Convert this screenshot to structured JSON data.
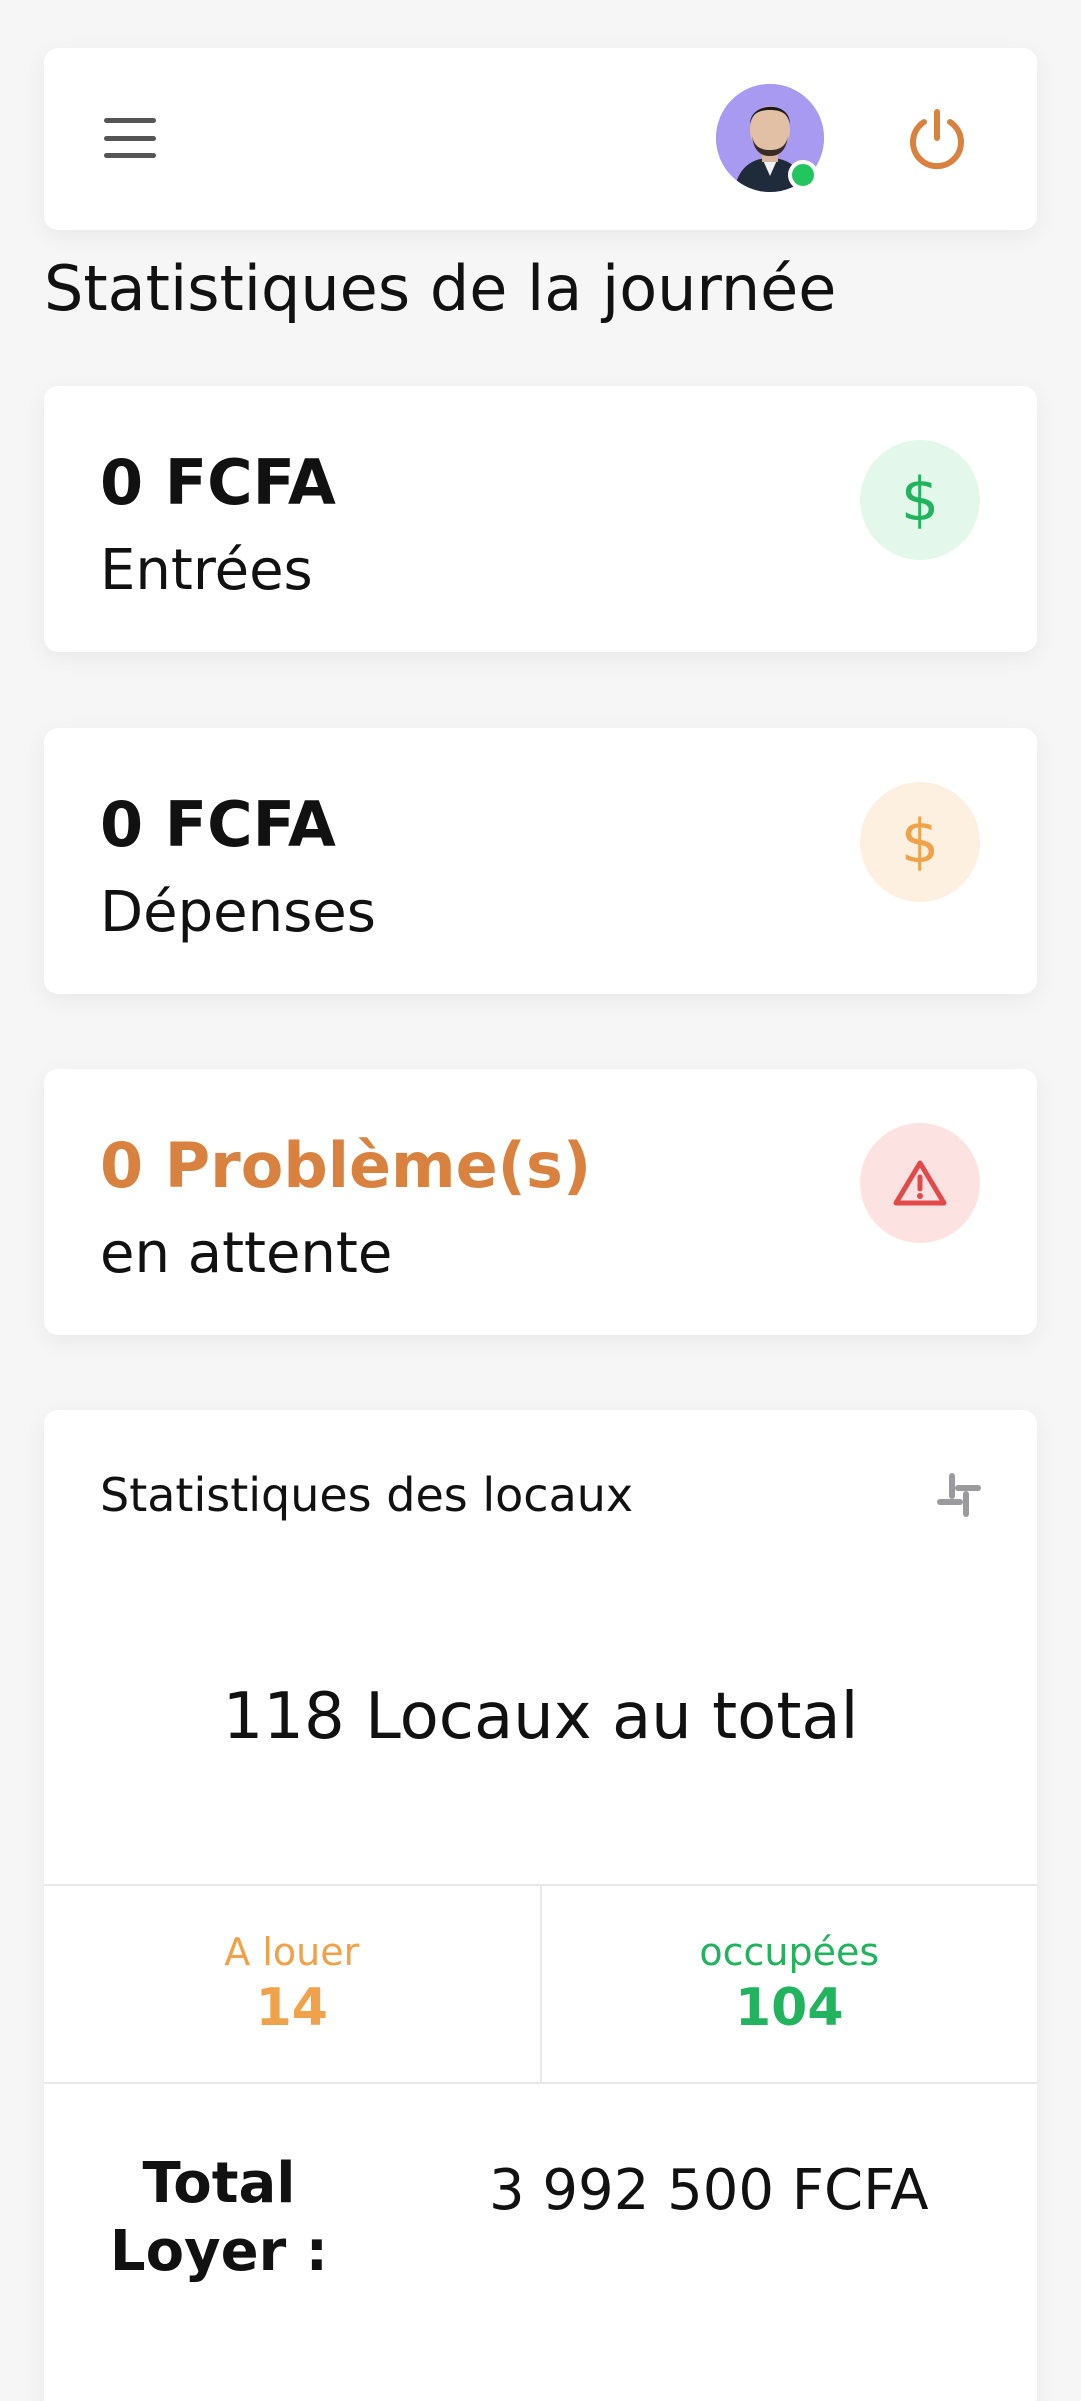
{
  "page_title": "Statistiques de la journée",
  "header": {
    "menu_icon": "hamburger-menu-icon",
    "avatar_alt": "user-avatar",
    "status_color": "#22c55e",
    "power_icon": "power-icon",
    "power_color": "#d9823f"
  },
  "stats": [
    {
      "value": "0 FCFA",
      "label": "Entrées",
      "icon": "dollar-icon",
      "color": "#22b35e"
    },
    {
      "value": "0 FCFA",
      "label": "Dépenses",
      "icon": "dollar-icon",
      "color": "#f0a24a"
    },
    {
      "value": "0 Problème(s)",
      "label": "en attente",
      "icon": "warning-triangle-icon",
      "color": "#e24a4a"
    }
  ],
  "locaux": {
    "title": "Statistiques des locaux",
    "total": "118 Locaux au total",
    "a_louer_label": "A louer",
    "a_louer_value": "14",
    "occupees_label": "occupées",
    "occupees_value": "104",
    "total_loyer_label": "Total Loyer :",
    "total_loyer_value": "3 992 500 FCFA"
  },
  "glyphs": {
    "dollar": "$"
  }
}
